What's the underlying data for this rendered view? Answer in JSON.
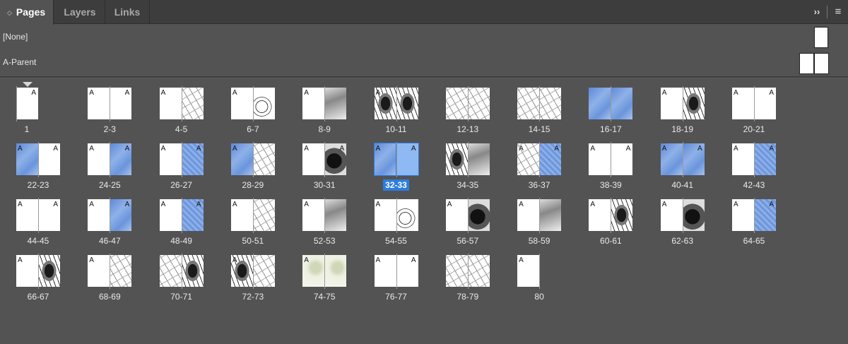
{
  "tabs": [
    {
      "label": "Pages",
      "active": true
    },
    {
      "label": "Layers",
      "active": false
    },
    {
      "label": "Links",
      "active": false
    }
  ],
  "panel_controls": {
    "collapse": "››",
    "menu": "≡"
  },
  "parents": [
    {
      "label": "[None]",
      "icon": "single-page-icon"
    },
    {
      "label": "A-Parent",
      "icon": "spread-page-icon"
    }
  ],
  "selected": "32-33",
  "spreads": [
    {
      "label": "1",
      "pages": [
        {
          "side": "r",
          "art": "",
          "letter": "A"
        }
      ]
    },
    {
      "label": "2-3",
      "pages": [
        {
          "side": "l",
          "art": "",
          "letter": "A"
        },
        {
          "side": "r",
          "art": "",
          "letter": "A"
        }
      ]
    },
    {
      "label": "4-5",
      "pages": [
        {
          "side": "l",
          "art": "",
          "letter": "A"
        },
        {
          "side": "r",
          "art": "sketch",
          "letter": ""
        }
      ]
    },
    {
      "label": "6-7",
      "pages": [
        {
          "side": "l",
          "art": "",
          "letter": "A"
        },
        {
          "side": "r",
          "art": "swirl",
          "letter": ""
        }
      ]
    },
    {
      "label": "8-9",
      "pages": [
        {
          "side": "l",
          "art": "",
          "letter": "A"
        },
        {
          "side": "r",
          "art": "grey",
          "letter": ""
        }
      ]
    },
    {
      "label": "10-11",
      "pages": [
        {
          "side": "l",
          "art": "ink",
          "letter": "A"
        },
        {
          "side": "r",
          "art": "ink",
          "letter": ""
        }
      ]
    },
    {
      "label": "12-13",
      "pages": [
        {
          "side": "l",
          "art": "sketch",
          "letter": ""
        },
        {
          "side": "r",
          "art": "sketch",
          "letter": ""
        }
      ]
    },
    {
      "label": "14-15",
      "pages": [
        {
          "side": "l",
          "art": "sketch",
          "letter": ""
        },
        {
          "side": "r",
          "art": "sketch",
          "letter": ""
        }
      ]
    },
    {
      "label": "16-17",
      "pages": [
        {
          "side": "l",
          "art": "blue",
          "letter": ""
        },
        {
          "side": "r",
          "art": "blue",
          "letter": ""
        }
      ]
    },
    {
      "label": "18-19",
      "pages": [
        {
          "side": "l",
          "art": "",
          "letter": "A"
        },
        {
          "side": "r",
          "art": "ink",
          "letter": ""
        }
      ]
    },
    {
      "label": "20-21",
      "pages": [
        {
          "side": "l",
          "art": "",
          "letter": "A"
        },
        {
          "side": "r",
          "art": "",
          "letter": "A"
        }
      ]
    },
    {
      "label": "22-23",
      "pages": [
        {
          "side": "l",
          "art": "blue",
          "letter": "A"
        },
        {
          "side": "r",
          "art": "",
          "letter": "A"
        }
      ]
    },
    {
      "label": "24-25",
      "pages": [
        {
          "side": "l",
          "art": "",
          "letter": "A"
        },
        {
          "side": "r",
          "art": "blue",
          "letter": "A"
        }
      ]
    },
    {
      "label": "26-27",
      "pages": [
        {
          "side": "l",
          "art": "",
          "letter": "A"
        },
        {
          "side": "r",
          "art": "blue2",
          "letter": "A"
        }
      ]
    },
    {
      "label": "28-29",
      "pages": [
        {
          "side": "l",
          "art": "blue",
          "letter": "A"
        },
        {
          "side": "r",
          "art": "sketch",
          "letter": ""
        }
      ]
    },
    {
      "label": "30-31",
      "pages": [
        {
          "side": "l",
          "art": "",
          "letter": "A"
        },
        {
          "side": "r",
          "art": "dark",
          "letter": "A"
        }
      ]
    },
    {
      "label": "32-33",
      "pages": [
        {
          "side": "l",
          "art": "blue",
          "letter": "A"
        },
        {
          "side": "r",
          "art": "lightblue",
          "letter": "A"
        }
      ]
    },
    {
      "label": "34-35",
      "pages": [
        {
          "side": "l",
          "art": "ink",
          "letter": ""
        },
        {
          "side": "r",
          "art": "grey",
          "letter": ""
        }
      ]
    },
    {
      "label": "36-37",
      "pages": [
        {
          "side": "l",
          "art": "sketch",
          "letter": "A"
        },
        {
          "side": "r",
          "art": "blue2",
          "letter": "A"
        }
      ]
    },
    {
      "label": "38-39",
      "pages": [
        {
          "side": "l",
          "art": "",
          "letter": "A"
        },
        {
          "side": "r",
          "art": "",
          "letter": "A"
        }
      ]
    },
    {
      "label": "40-41",
      "pages": [
        {
          "side": "l",
          "art": "blue",
          "letter": "A"
        },
        {
          "side": "r",
          "art": "blue",
          "letter": "A"
        }
      ]
    },
    {
      "label": "42-43",
      "pages": [
        {
          "side": "l",
          "art": "",
          "letter": "A"
        },
        {
          "side": "r",
          "art": "blue2",
          "letter": "A"
        }
      ]
    },
    {
      "label": "44-45",
      "pages": [
        {
          "side": "l",
          "art": "",
          "letter": "A"
        },
        {
          "side": "r",
          "art": "",
          "letter": "A"
        }
      ]
    },
    {
      "label": "46-47",
      "pages": [
        {
          "side": "l",
          "art": "",
          "letter": "A"
        },
        {
          "side": "r",
          "art": "blue",
          "letter": "A"
        }
      ]
    },
    {
      "label": "48-49",
      "pages": [
        {
          "side": "l",
          "art": "",
          "letter": "A"
        },
        {
          "side": "r",
          "art": "blue2",
          "letter": "A"
        }
      ]
    },
    {
      "label": "50-51",
      "pages": [
        {
          "side": "l",
          "art": "",
          "letter": "A"
        },
        {
          "side": "r",
          "art": "sketch",
          "letter": ""
        }
      ]
    },
    {
      "label": "52-53",
      "pages": [
        {
          "side": "l",
          "art": "",
          "letter": "A"
        },
        {
          "side": "r",
          "art": "grey",
          "letter": ""
        }
      ]
    },
    {
      "label": "54-55",
      "pages": [
        {
          "side": "l",
          "art": "",
          "letter": "A"
        },
        {
          "side": "r",
          "art": "swirl",
          "letter": ""
        }
      ]
    },
    {
      "label": "56-57",
      "pages": [
        {
          "side": "l",
          "art": "",
          "letter": "A"
        },
        {
          "side": "r",
          "art": "dark",
          "letter": ""
        }
      ]
    },
    {
      "label": "58-59",
      "pages": [
        {
          "side": "l",
          "art": "",
          "letter": "A"
        },
        {
          "side": "r",
          "art": "grey",
          "letter": ""
        }
      ]
    },
    {
      "label": "60-61",
      "pages": [
        {
          "side": "l",
          "art": "",
          "letter": "A"
        },
        {
          "side": "r",
          "art": "ink",
          "letter": ""
        }
      ]
    },
    {
      "label": "62-63",
      "pages": [
        {
          "side": "l",
          "art": "",
          "letter": "A"
        },
        {
          "side": "r",
          "art": "dark",
          "letter": ""
        }
      ]
    },
    {
      "label": "64-65",
      "pages": [
        {
          "side": "l",
          "art": "",
          "letter": "A"
        },
        {
          "side": "r",
          "art": "blue2",
          "letter": "A"
        }
      ]
    },
    {
      "label": "66-67",
      "pages": [
        {
          "side": "l",
          "art": "",
          "letter": "A"
        },
        {
          "side": "r",
          "art": "ink",
          "letter": ""
        }
      ]
    },
    {
      "label": "68-69",
      "pages": [
        {
          "side": "l",
          "art": "",
          "letter": "A"
        },
        {
          "side": "r",
          "art": "sketch",
          "letter": ""
        }
      ]
    },
    {
      "label": "70-71",
      "pages": [
        {
          "side": "l",
          "art": "sketch",
          "letter": ""
        },
        {
          "side": "r",
          "art": "ink",
          "letter": ""
        }
      ]
    },
    {
      "label": "72-73",
      "pages": [
        {
          "side": "l",
          "art": "ink",
          "letter": "A"
        },
        {
          "side": "r",
          "art": "sketch",
          "letter": ""
        }
      ]
    },
    {
      "label": "74-75",
      "pages": [
        {
          "side": "l",
          "art": "cream",
          "letter": "A"
        },
        {
          "side": "r",
          "art": "cream",
          "letter": ""
        }
      ]
    },
    {
      "label": "76-77",
      "pages": [
        {
          "side": "l",
          "art": "",
          "letter": "A"
        },
        {
          "side": "r",
          "art": "",
          "letter": "A"
        }
      ]
    },
    {
      "label": "78-79",
      "pages": [
        {
          "side": "l",
          "art": "sketch",
          "letter": ""
        },
        {
          "side": "r",
          "art": "sketch",
          "letter": ""
        }
      ]
    },
    {
      "label": "80",
      "pages": [
        {
          "side": "l",
          "art": "",
          "letter": "A"
        }
      ]
    }
  ]
}
